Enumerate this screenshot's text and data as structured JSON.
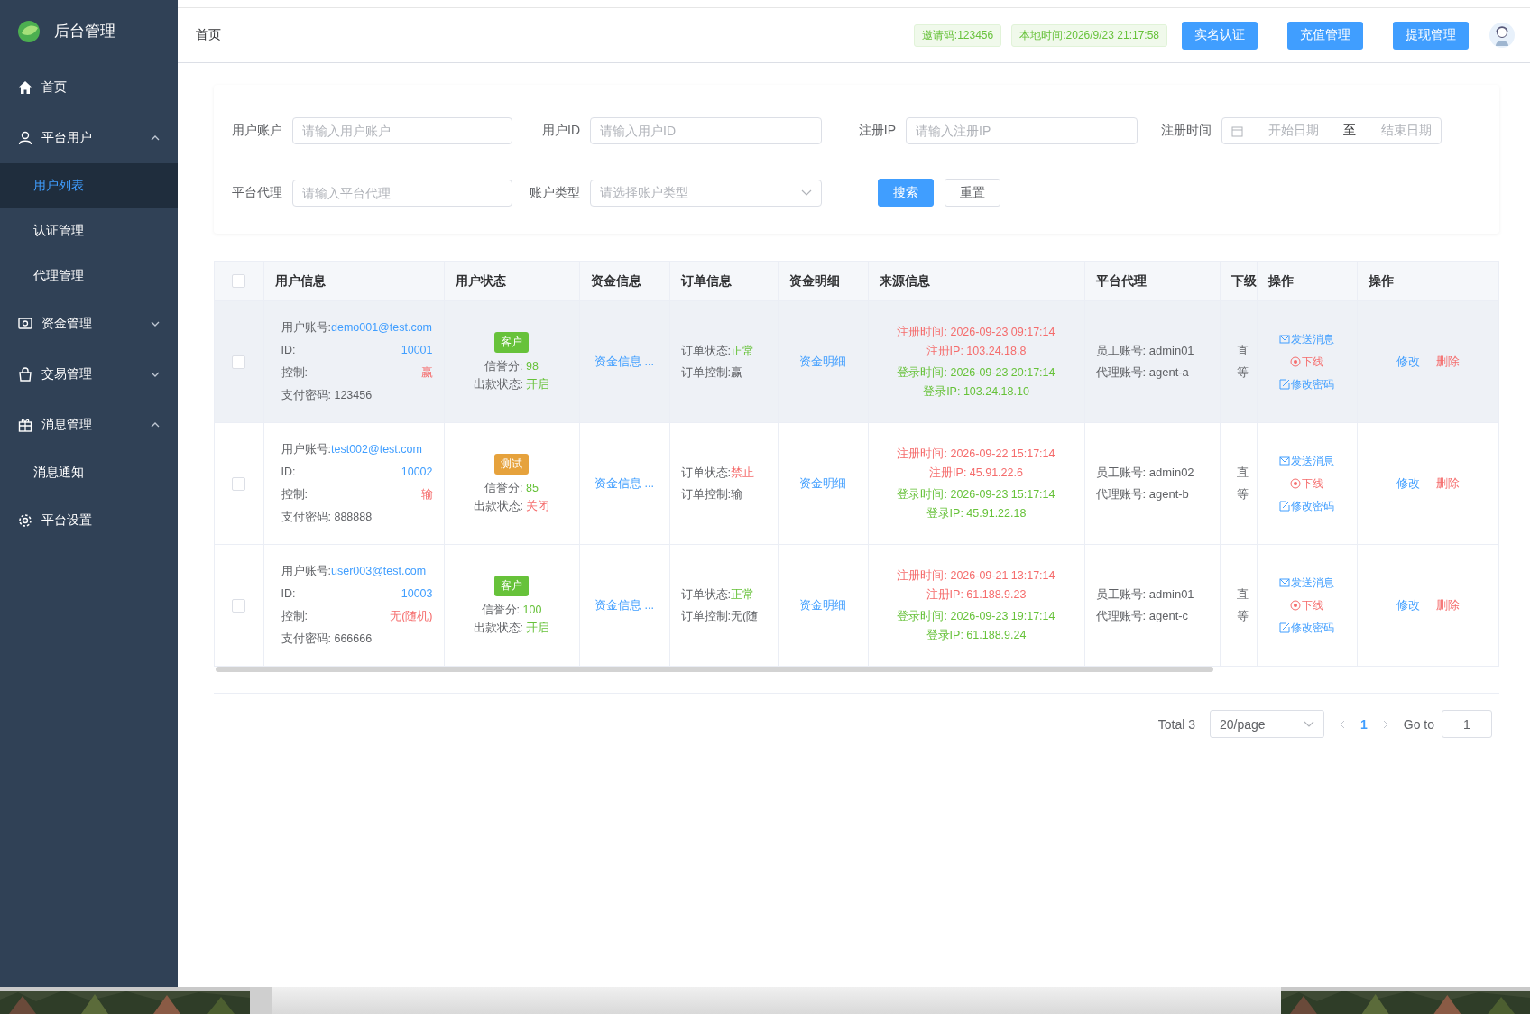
{
  "sidebar": {
    "title": "后台管理",
    "items": [
      {
        "label": "首页",
        "kind": "link"
      },
      {
        "label": "平台用户",
        "kind": "group",
        "expanded": true,
        "children": [
          {
            "label": "用户列表",
            "selected": true
          },
          {
            "label": "认证管理",
            "selected": false
          },
          {
            "label": "代理管理",
            "selected": false
          }
        ]
      },
      {
        "label": "资金管理",
        "kind": "group",
        "expanded": false
      },
      {
        "label": "交易管理",
        "kind": "group",
        "expanded": false
      },
      {
        "label": "消息管理",
        "kind": "group",
        "expanded": true,
        "children": [
          {
            "label": "消息通知",
            "selected": false
          }
        ]
      },
      {
        "label": "平台设置",
        "kind": "link"
      }
    ]
  },
  "header": {
    "breadcrumb": "首页",
    "tags": [
      "邀请码:123456",
      "本地时间:2026/9/23 21:17:58"
    ],
    "buttons": [
      "实名认证",
      "充值管理",
      "提现管理"
    ]
  },
  "filters": [
    {
      "kind": "input",
      "label": "用户账户",
      "placeholder": "请输入用户账户"
    },
    {
      "kind": "input",
      "label": "用户ID",
      "placeholder": "请输入用户ID"
    },
    {
      "kind": "input",
      "label": "注册IP",
      "placeholder": "请输入注册IP"
    },
    {
      "kind": "daterange",
      "label": "注册时间",
      "start_placeholder": "开始日期",
      "separator": "至",
      "end_placeholder": "结束日期"
    },
    {
      "kind": "input",
      "label": "平台代理",
      "placeholder": "请输入平台代理"
    },
    {
      "kind": "select",
      "label": "账户类型",
      "placeholder": "请选择账户类型"
    }
  ],
  "filter_buttons": [
    {
      "label": "搜索",
      "kind": "primary"
    },
    {
      "label": "重置",
      "kind": "default"
    }
  ],
  "table": {
    "select_all": false,
    "columns": [
      "用户信息",
      "用户状态",
      "资金信息",
      "订单信息",
      "资金明细",
      "来源信息",
      "平台代理",
      "下级",
      "操作",
      "操作"
    ],
    "rows": [
      {
        "checked": false,
        "hovered": true,
        "account_label": "用户账号:",
        "account": "demo001@test.com",
        "id_label": "ID:",
        "id": "10001",
        "control_label": "控制:",
        "control": "赢",
        "pay_password": "支付密码: 123456",
        "tag": {
          "text": "客户",
          "color": "#67c23a"
        },
        "credit_label": "信誉分:",
        "credit": "98",
        "payout_label": "出款状态:",
        "payout": {
          "text": "开启",
          "color": "#67c23a"
        },
        "funds": "资金信息 ...",
        "order_status_label": "订单状态:",
        "order_status": {
          "text": "正常",
          "color": "#67c23a"
        },
        "order_control": "订单控制:赢",
        "detail": "资金明细",
        "reg_time": "注册时间:  2026-09-23 09:17:14",
        "reg_ip": "注册IP:  103.24.18.8",
        "login_time": "登录时间:  2026-09-23 20:17:14",
        "login_ip": "登录IP:  103.24.18.10",
        "staff": "员工账号: admin01",
        "agent": "代理账号: agent-a",
        "sub_1": "直",
        "sub_2": "等",
        "ops": [
          "发送消息",
          "下线",
          "修改密码"
        ],
        "actions": [
          "修改",
          "删除"
        ]
      },
      {
        "checked": false,
        "hovered": false,
        "account_label": "用户账号:",
        "account": "test002@test.com",
        "id_label": "ID:",
        "id": "10002",
        "control_label": "控制:",
        "control": "输",
        "pay_password": "支付密码: 888888",
        "tag": {
          "text": "测试",
          "color": "#e6a23c"
        },
        "credit_label": "信誉分:",
        "credit": "85",
        "payout_label": "出款状态:",
        "payout": {
          "text": "关闭",
          "color": "#f56c6c"
        },
        "funds": "资金信息 ...",
        "order_status_label": "订单状态:",
        "order_status": {
          "text": "禁止",
          "color": "#f56c6c"
        },
        "order_control": "订单控制:输",
        "detail": "资金明细",
        "reg_time": "注册时间:  2026-09-22 15:17:14",
        "reg_ip": "注册IP:  45.91.22.6",
        "login_time": "登录时间:  2026-09-23 15:17:14",
        "login_ip": "登录IP:  45.91.22.18",
        "staff": "员工账号: admin02",
        "agent": "代理账号: agent-b",
        "sub_1": "直",
        "sub_2": "等",
        "ops": [
          "发送消息",
          "下线",
          "修改密码"
        ],
        "actions": [
          "修改",
          "删除"
        ]
      },
      {
        "checked": false,
        "hovered": false,
        "account_label": "用户账号:",
        "account": "user003@test.com",
        "id_label": "ID:",
        "id": "10003",
        "control_label": "控制:",
        "control": "无(随机)",
        "pay_password": "支付密码: 666666",
        "tag": {
          "text": "客户",
          "color": "#67c23a"
        },
        "credit_label": "信誉分:",
        "credit": "100",
        "payout_label": "出款状态:",
        "payout": {
          "text": "开启",
          "color": "#67c23a"
        },
        "funds": "资金信息 ...",
        "order_status_label": "订单状态:",
        "order_status": {
          "text": "正常",
          "color": "#67c23a"
        },
        "order_control": "订单控制:无(随",
        "detail": "资金明细",
        "reg_time": "注册时间:  2026-09-21 13:17:14",
        "reg_ip": "注册IP:  61.188.9.23",
        "login_time": "登录时间:  2026-09-23 19:17:14",
        "login_ip": "登录IP:  61.188.9.24",
        "staff": "员工账号: admin01",
        "agent": "代理账号: agent-c",
        "sub_1": "直",
        "sub_2": "等",
        "ops": [
          "发送消息",
          "下线",
          "修改密码"
        ],
        "actions": [
          "修改",
          "删除"
        ]
      }
    ]
  },
  "pagination": {
    "total": "Total 3",
    "page_size": "20/page",
    "pages": [
      {
        "label": "1",
        "selected": true
      }
    ],
    "goto_label": "Go to",
    "goto_value": "1"
  }
}
